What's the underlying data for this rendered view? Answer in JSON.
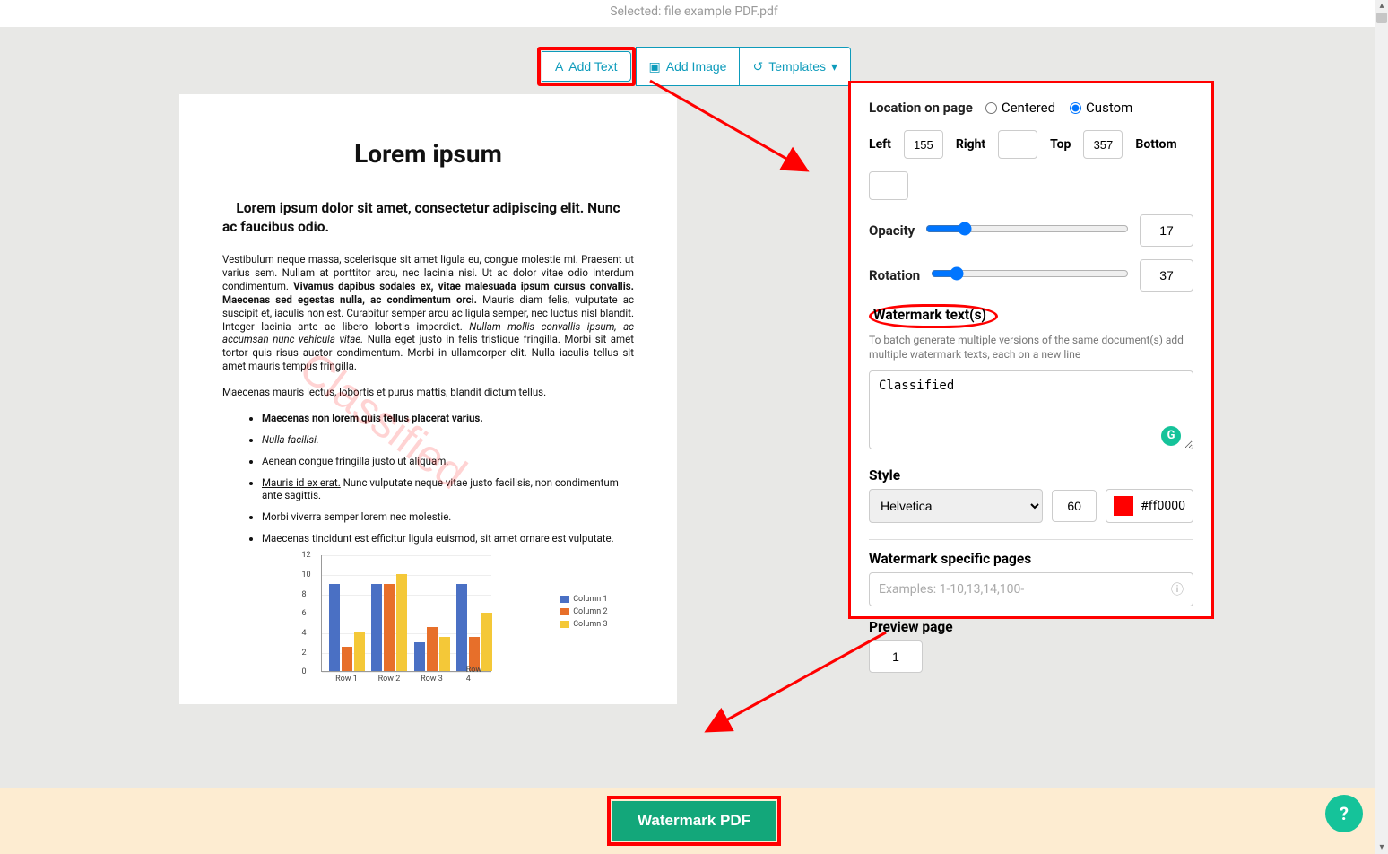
{
  "topbar": {
    "selected_label": "Selected: file example PDF.pdf"
  },
  "buttons": {
    "add_text": "Add Text",
    "add_image": "Add Image",
    "templates": "Templates"
  },
  "doc": {
    "title": "Lorem ipsum",
    "subhead": "Lorem ipsum dolor sit amet, consectetur adipiscing elit. Nunc ac faucibus odio.",
    "p1_a": "Vestibulum neque massa, scelerisque sit amet ligula eu, congue molestie mi. Praesent ut varius sem. Nullam at porttitor arcu, nec lacinia nisi. Ut ac dolor vitae odio interdum condimentum. ",
    "p1_b": "Vivamus dapibus sodales ex, vitae malesuada ipsum cursus convallis. Maecenas sed egestas nulla, ac condimentum orci.",
    "p1_c": " Mauris diam felis, vulputate ac suscipit et, iaculis non est. Curabitur semper arcu ac ligula semper, nec luctus nisl blandit. Integer lacinia ante ac libero lobortis imperdiet. ",
    "p1_d": "Nullam mollis convallis ipsum, ac accumsan nunc vehicula vitae.",
    "p1_e": " Nulla eget justo in felis tristique fringilla. Morbi sit amet tortor quis risus auctor condimentum. Morbi in ullamcorper elit. Nulla iaculis tellus sit amet mauris tempus fringilla.",
    "p2": "Maecenas mauris lectus, lobortis et purus mattis, blandit dictum tellus.",
    "li1": "Maecenas non lorem quis tellus placerat varius.",
    "li2": "Nulla facilisi.",
    "li3": "Aenean congue fringilla justo ut aliquam.",
    "li4a": "Mauris id ex erat.",
    "li4b": " Nunc vulputate neque vitae justo facilisis, non condimentum ante sagittis.",
    "li5": "Morbi viverra semper lorem nec molestie.",
    "li6": "Maecenas tincidunt est efficitur ligula euismod, sit amet ornare est vulputate."
  },
  "watermark_preview": "Classified",
  "chart_data": {
    "type": "bar",
    "categories": [
      "Row 1",
      "Row 2",
      "Row 3",
      "Row 4"
    ],
    "series": [
      {
        "name": "Column 1",
        "values": [
          9,
          9,
          3,
          9
        ],
        "color": "#4a70c4"
      },
      {
        "name": "Column 2",
        "values": [
          2.5,
          9,
          4.5,
          3.5
        ],
        "color": "#e76f2a"
      },
      {
        "name": "Column 3",
        "values": [
          4,
          10,
          3.5,
          6
        ],
        "color": "#f4c838"
      }
    ],
    "ylim": [
      0,
      12
    ],
    "yticks": [
      0,
      2,
      4,
      6,
      8,
      10,
      12
    ]
  },
  "panel": {
    "location_label": "Location on page",
    "centered": "Centered",
    "custom": "Custom",
    "left": "Left",
    "left_val": "155",
    "right": "Right",
    "right_val": "",
    "top": "Top",
    "top_val": "357",
    "bottom": "Bottom",
    "bottom_val": "",
    "opacity": "Opacity",
    "opacity_val": "17",
    "rotation": "Rotation",
    "rotation_val": "37",
    "wm_title": "Watermark text(s)",
    "wm_help": "To batch generate multiple versions of the same document(s) add multiple watermark texts, each on a new line",
    "wm_text": "Classified",
    "style": "Style",
    "font": "Helvetica",
    "size": "60",
    "color": "#ff0000",
    "pages_title": "Watermark specific pages",
    "pages_placeholder": "Examples: 1-10,13,14,100-",
    "preview_page": "Preview page",
    "preview_page_val": "1"
  },
  "action": {
    "button": "Watermark PDF"
  }
}
